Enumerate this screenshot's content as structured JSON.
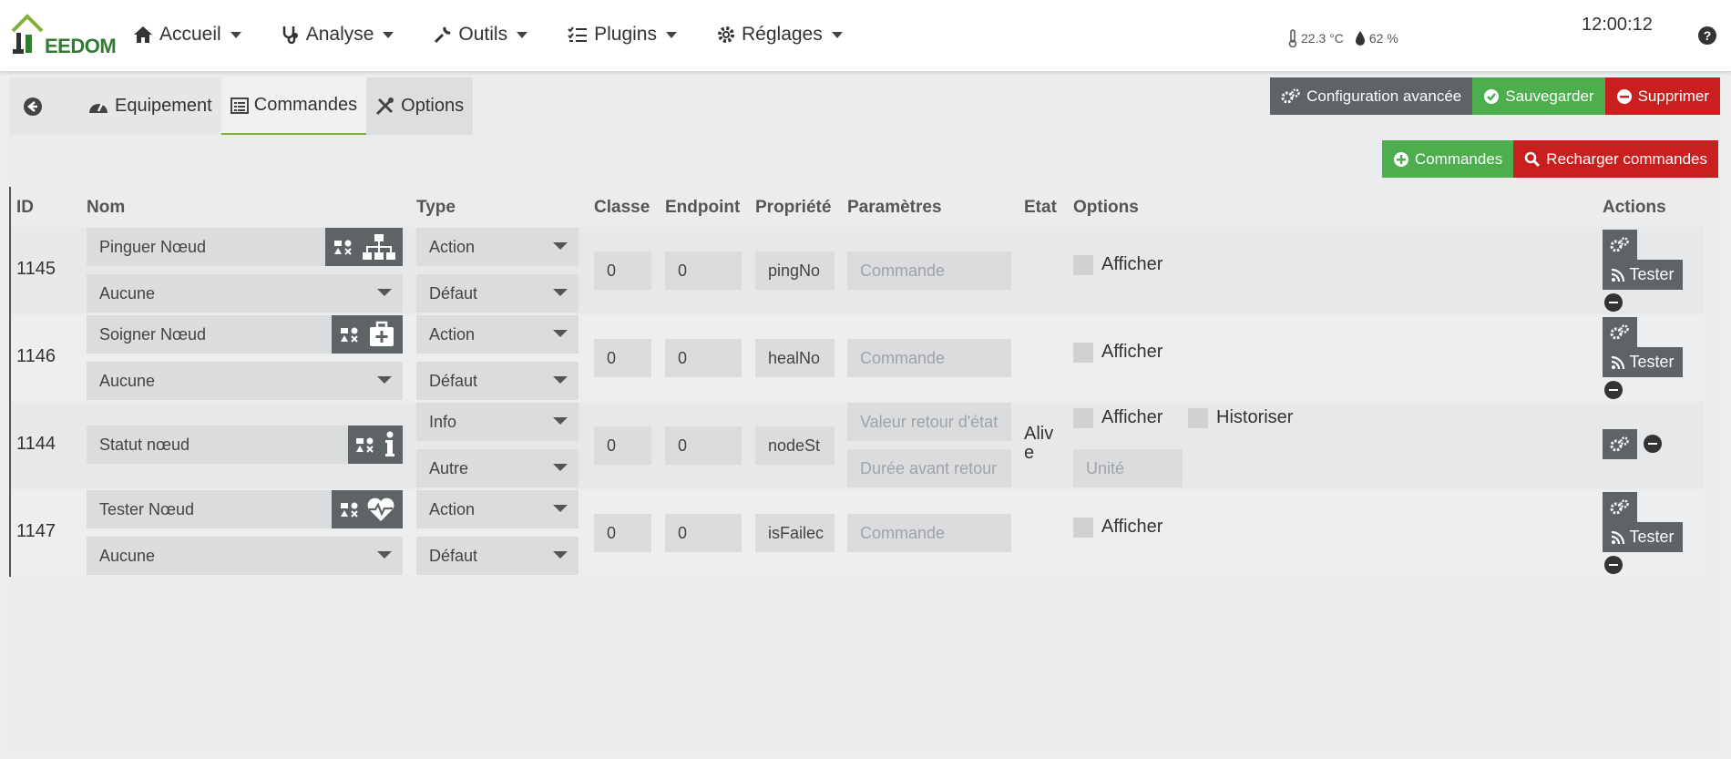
{
  "brand": {
    "logo_text": "EEDOM"
  },
  "nav": [
    {
      "label": "Accueil",
      "icon": "home-icon"
    },
    {
      "label": "Analyse",
      "icon": "stethoscope-icon"
    },
    {
      "label": "Outils",
      "icon": "wrench-icon"
    },
    {
      "label": "Plugins",
      "icon": "tasks-icon"
    },
    {
      "label": "Réglages",
      "icon": "gear-icon"
    }
  ],
  "weather": {
    "temperature": "22.3 °C",
    "humidity": "62 %"
  },
  "clock": "12:00:12",
  "help_label": "?",
  "tabs": {
    "equipement": "Equipement",
    "commandes": "Commandes",
    "options": "Options"
  },
  "buttons": {
    "config_avancee": "Configuration avancée",
    "sauvegarder": "Sauvegarder",
    "supprimer": "Supprimer",
    "add_commandes": "Commandes",
    "recharger": "Recharger commandes",
    "tester": "Tester"
  },
  "columns": {
    "id": "ID",
    "nom": "Nom",
    "type": "Type",
    "classe": "Classe",
    "endpoint": "Endpoint",
    "propriete": "Propriété",
    "parametres": "Paramètres",
    "etat": "Etat",
    "options": "Options",
    "actions": "Actions"
  },
  "commands": [
    {
      "id": "1145",
      "name": "Pinguer Nœud",
      "sub": "Aucune",
      "type": "Action",
      "subtype": "Défaut",
      "classe": "0",
      "endpoint": "0",
      "propriete": "pingNo",
      "param_placeholder": "Commande",
      "afficher": "Afficher",
      "icon": "sitemap-icon"
    },
    {
      "id": "1146",
      "name": "Soigner Nœud",
      "sub": "Aucune",
      "type": "Action",
      "subtype": "Défaut",
      "classe": "0",
      "endpoint": "0",
      "propriete": "healNo",
      "param_placeholder": "Commande",
      "afficher": "Afficher",
      "icon": "medkit-icon"
    },
    {
      "id": "1144",
      "name": "Statut nœud",
      "type": "Info",
      "subtype": "Autre",
      "classe": "0",
      "endpoint": "0",
      "propriete": "nodeSt",
      "param_placeholder": "Valeur retour d'état",
      "param2_placeholder": "Durée avant retour",
      "etat": "Alive",
      "afficher": "Afficher",
      "historiser": "Historiser",
      "unite_placeholder": "Unité",
      "icon": "info-icon"
    },
    {
      "id": "1147",
      "name": "Tester Nœud",
      "sub": "Aucune",
      "type": "Action",
      "subtype": "Défaut",
      "classe": "0",
      "endpoint": "0",
      "propriete": "isFailec",
      "param_placeholder": "Commande",
      "afficher": "Afficher",
      "icon": "heartbeat-icon"
    }
  ]
}
